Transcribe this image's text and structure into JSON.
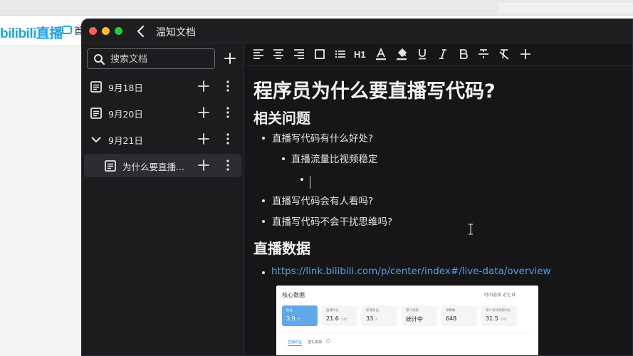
{
  "background": {
    "logo_text": "bilibili直播",
    "nav_label": "首"
  },
  "window": {
    "title": "温知文档"
  },
  "sidebar": {
    "search_placeholder": "搜索文档",
    "items": [
      {
        "label": "9月18日",
        "icon": "document-icon"
      },
      {
        "label": "9月20日",
        "icon": "document-icon"
      },
      {
        "label": "9月21日",
        "icon": "chevron-down-icon"
      },
      {
        "label": "为什么要直播...",
        "icon": "document-icon",
        "selected": true
      }
    ]
  },
  "toolbar": {
    "heading_label": "H1",
    "tools": [
      "align-left",
      "align-center",
      "align-right",
      "box",
      "bullet-list",
      "H1",
      "font-color",
      "highlight",
      "underline",
      "italic",
      "bold",
      "strikethrough",
      "clear-format",
      "add"
    ]
  },
  "document": {
    "title": "程序员为什么要直播写代码?",
    "section1": "相关问题",
    "q1": "直播写代码有什么好处?",
    "q1_sub": "直播流量比视频稳定",
    "q2": "直播写代码会有人看吗?",
    "q3": "直播写代码不会干扰思维吗?",
    "section2": "直播数据",
    "link": "https://link.bilibili.com/p/center/index#/live-data/overview"
  },
  "embedded": {
    "title": "核心数据",
    "filter_label": "时间选择",
    "filter_value": "近七日",
    "cards": [
      {
        "label": "收益",
        "value": "3.9",
        "unit": "元",
        "active": true
      },
      {
        "label": "直播时长",
        "value": "21.6",
        "unit": "小时"
      },
      {
        "label": "新增粉丝",
        "value": "33",
        "unit": "人"
      },
      {
        "label": "累计观看",
        "value": "统计中",
        "unit": ""
      },
      {
        "label": "弹幕数",
        "value": "648",
        "unit": ""
      },
      {
        "label": "累计有效观看时长",
        "value": "31.5",
        "unit": "小时"
      }
    ],
    "tab_active": "直播收益",
    "tab_other": "送礼来源"
  }
}
